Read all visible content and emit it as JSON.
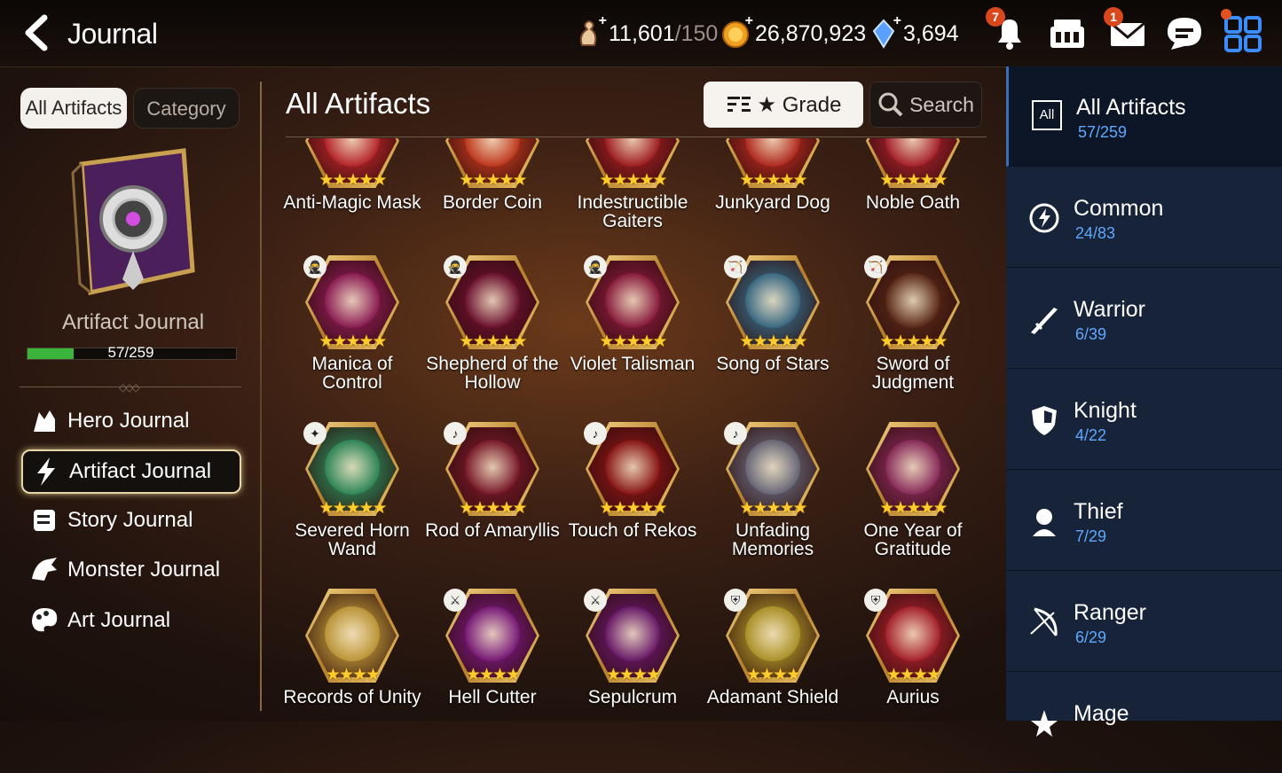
{
  "header": {
    "title": "Journal",
    "stamina": {
      "value": "11,601",
      "max": "/150"
    },
    "gold": "26,870,923",
    "crystals": "3,694",
    "notifications_badge": "7",
    "mail_badge": "1"
  },
  "left_panel": {
    "tabs": [
      {
        "label": "All Artifacts",
        "selected": true
      },
      {
        "label": "Category",
        "selected": false
      }
    ],
    "book_label": "Artifact Journal",
    "progress": {
      "text": "57/259",
      "fraction": 0.22
    },
    "nav": [
      {
        "label": "Hero Journal",
        "icon": "hero-icon",
        "active": false
      },
      {
        "label": "Artifact Journal",
        "icon": "lightning-icon",
        "active": true
      },
      {
        "label": "Story Journal",
        "icon": "scroll-icon",
        "active": false
      },
      {
        "label": "Monster Journal",
        "icon": "dragon-icon",
        "active": false
      },
      {
        "label": "Art Journal",
        "icon": "palette-icon",
        "active": false
      }
    ]
  },
  "main": {
    "title": "All Artifacts",
    "grade_button": "★ Grade",
    "search_button": "Search",
    "artifacts": [
      {
        "name": "Anti-Magic Mask",
        "stars": 5,
        "class": "",
        "color": "#b8262a"
      },
      {
        "name": "Border Coin",
        "stars": 5,
        "class": "",
        "color": "#c23a1e"
      },
      {
        "name": "Indestructible Gaiters",
        "stars": 5,
        "class": "",
        "color": "#a11f22"
      },
      {
        "name": "Junkyard Dog",
        "stars": 5,
        "class": "",
        "color": "#b32b1f"
      },
      {
        "name": "Noble Oath",
        "stars": 5,
        "class": "",
        "color": "#a8222c"
      },
      {
        "name": "Manica of Control",
        "stars": 5,
        "class": "thief",
        "color": "#8e1d55"
      },
      {
        "name": "Shepherd of the Hollow",
        "stars": 5,
        "class": "thief",
        "color": "#6e1230"
      },
      {
        "name": "Violet Talisman",
        "stars": 5,
        "class": "thief",
        "color": "#8a1c3c"
      },
      {
        "name": "Song of Stars",
        "stars": 5,
        "class": "ranger",
        "color": "#3a6c86"
      },
      {
        "name": "Sword of Judgment",
        "stars": 5,
        "class": "ranger",
        "color": "#5a2a18"
      },
      {
        "name": "Severed Horn Wand",
        "stars": 5,
        "class": "mage",
        "color": "#2f8a5a"
      },
      {
        "name": "Rod of Amaryllis",
        "stars": 5,
        "class": "soul",
        "color": "#7a1a2a"
      },
      {
        "name": "Touch of Rekos",
        "stars": 5,
        "class": "soul",
        "color": "#8a1616"
      },
      {
        "name": "Unfading Memories",
        "stars": 5,
        "class": "soul",
        "color": "#6a6a7a"
      },
      {
        "name": "One Year of Gratitude",
        "stars": 5,
        "class": "",
        "color": "#8a2c5a"
      },
      {
        "name": "Records of Unity",
        "stars": 4,
        "class": "",
        "color": "#c09a3a"
      },
      {
        "name": "Hell Cutter",
        "stars": 4,
        "class": "warrior",
        "color": "#7a1a7a"
      },
      {
        "name": "Sepulcrum",
        "stars": 4,
        "class": "warrior",
        "color": "#6a1a6a"
      },
      {
        "name": "Adamant Shield",
        "stars": 4,
        "class": "knight",
        "color": "#b0962a"
      },
      {
        "name": "Aurius",
        "stars": 4,
        "class": "knight",
        "color": "#a8222c"
      }
    ]
  },
  "right_panel": {
    "categories": [
      {
        "label": "All Artifacts",
        "count": "57/259",
        "icon": "all-icon",
        "active": true
      },
      {
        "label": "Common",
        "count": "24/83",
        "icon": "common-icon",
        "active": false
      },
      {
        "label": "Warrior",
        "count": "6/39",
        "icon": "warrior-icon",
        "active": false
      },
      {
        "label": "Knight",
        "count": "4/22",
        "icon": "knight-icon",
        "active": false
      },
      {
        "label": "Thief",
        "count": "7/29",
        "icon": "thief-icon",
        "active": false
      },
      {
        "label": "Ranger",
        "count": "6/29",
        "icon": "ranger-icon",
        "active": false
      },
      {
        "label": "Mage",
        "count": "",
        "icon": "mage-icon",
        "active": false
      }
    ],
    "all_box_text": "All"
  }
}
